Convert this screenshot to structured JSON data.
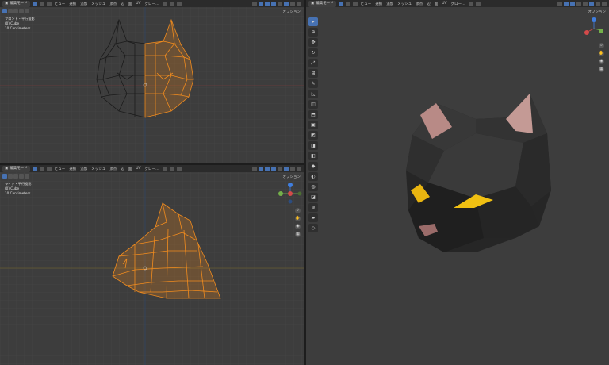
{
  "header": {
    "mode_label": "編集モード",
    "menus": [
      "ビュー",
      "選択",
      "追加",
      "メッシュ",
      "頂点",
      "辺",
      "面",
      "UV"
    ],
    "transform_label": "グロー…",
    "options_label": "オプション"
  },
  "viewports": {
    "front": {
      "view_name": "フロント・平行投影",
      "object": "(0) Cube",
      "scale": "10 Centimeters"
    },
    "right": {
      "view_name": "ライト・平行投影",
      "object": "(0) Cube",
      "scale": "10 Centimeters"
    }
  },
  "gizmo": {
    "z": "Z",
    "x": "X",
    "y": "Y"
  },
  "colors": {
    "selected": "#f28c1e",
    "x_axis": "#d44a4a",
    "y_axis": "#74b04a",
    "z_axis": "#3f7ee0",
    "viewport_bg": "#3d3d3d",
    "header_bg": "#2b2b2b"
  },
  "icons": [
    "select-box-icon",
    "cursor-icon",
    "move-icon",
    "rotate-icon",
    "scale-icon",
    "transform-icon",
    "annotate-icon",
    "measure-icon",
    "add-cube-icon",
    "extrude-icon",
    "inset-icon",
    "bevel-icon",
    "loop-cut-icon",
    "knife-icon",
    "poly-build-icon",
    "spin-icon",
    "smooth-icon",
    "edge-slide-icon",
    "shrink-icon",
    "shear-icon",
    "rip-icon",
    "zoom-icon",
    "hand-icon",
    "camera-icon",
    "grid-icon"
  ]
}
